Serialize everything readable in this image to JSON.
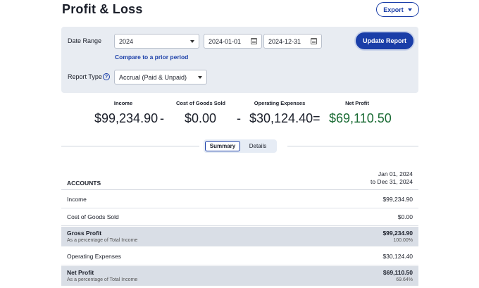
{
  "page": {
    "title": "Profit & Loss",
    "export_label": "Export"
  },
  "filters": {
    "date_range_label": "Date Range",
    "date_range_value": "2024",
    "start_date": "2024-01-01",
    "end_date": "2024-12-31",
    "compare_link": "Compare to a prior period",
    "report_type_label": "Report Type",
    "report_type_help": "?",
    "report_type_value": "Accrual (Paid & Unpaid)",
    "update_label": "Update Report"
  },
  "summary": {
    "income_label": "Income",
    "income_value": "$99,234.90",
    "cogs_label": "Cost of Goods Sold",
    "cogs_value": "$0.00",
    "opex_label": "Operating Expenses",
    "opex_value": "$30,124.40",
    "net_label": "Net Profit",
    "net_value": "$69,110.50",
    "op_minus": "-",
    "op_equals": "=",
    "net_color": "#1a6b34"
  },
  "view_toggle": {
    "summary_label": "Summary",
    "details_label": "Details",
    "active": "Summary"
  },
  "table": {
    "accounts_header": "ACCOUNTS",
    "period_line1": "Jan 01, 2024",
    "period_line2": "to Dec 31, 2024",
    "rows": [
      {
        "label": "Income",
        "amount": "$99,234.90"
      },
      {
        "label": "Cost of Goods Sold",
        "amount": "$0.00"
      },
      {
        "label": "Gross Profit",
        "amount": "$99,234.90",
        "sub_label": "As a percentage of Total Income",
        "sub_amount": "100.00%"
      },
      {
        "label": "Operating Expenses",
        "amount": "$30,124.40"
      },
      {
        "label": "Net Profit",
        "amount": "$69,110.50",
        "sub_label": "As a percentage of Total Income",
        "sub_amount": "69.64%"
      }
    ]
  },
  "colors": {
    "accent": "#1a3ea8",
    "panel_bg": "#e8ecf2",
    "shaded_row": "#d9dee6"
  }
}
